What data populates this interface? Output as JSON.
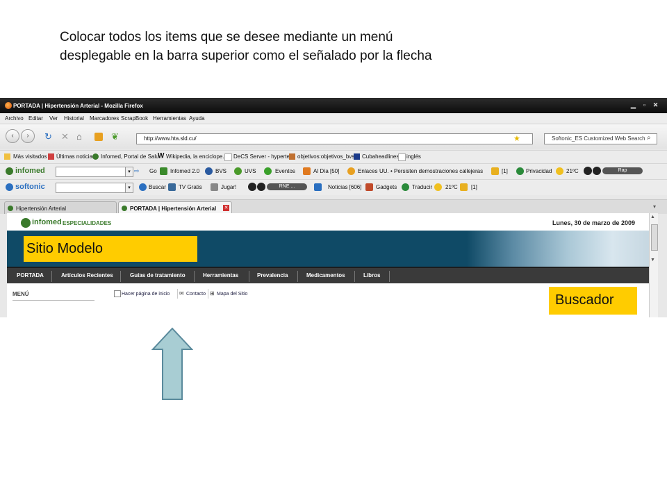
{
  "instruction": {
    "line1": "Colocar todos los items que se desee mediante un menú",
    "line2": "desplegable en la barra superior como el señalado por la flecha"
  },
  "browser": {
    "window_title": "PORTADA | Hipertensión Arterial - Mozilla Firefox",
    "menu": [
      "Archivo",
      "Editar",
      "Ver",
      "Historial",
      "Marcadores",
      "ScrapBook",
      "Herramientas",
      "Ayuda"
    ],
    "url": "http://www.hta.sld.cu/",
    "search_placeholder": "Softonic_ES Customized Web Search",
    "bookmarks": [
      "Más visitados",
      "Últimas noticias",
      "Infomed, Portal de Salu...",
      "Wikipedia, la enciclope...",
      "DeCS Server - hyperte...",
      "objetivos:objetivos_bvs...",
      "Cubaheadlines",
      "inglés"
    ],
    "infomed_toolbar": {
      "brand": "infomed",
      "go": "Go",
      "items": [
        "Infomed 2.0",
        "BVS",
        "UVS",
        "Eventos",
        "Al Día [50]",
        "Enlaces"
      ],
      "ticker": "UU. • Persisten demostraciones callejeras",
      "mail_count": "[1]",
      "privacy": "Privacidad",
      "temp": "21ºC",
      "radio": "Rap"
    },
    "softonic_toolbar": {
      "brand": "softonic",
      "items": [
        "Buscar",
        "TV Gratis",
        "Jugar!"
      ],
      "radio": "RNE ...",
      "news": "Noticias [606]",
      "gadgets": "Gadgets",
      "translate": "Traducir",
      "temp": "21ºC",
      "count": "[1]"
    },
    "tabs": [
      "Hipertensión Arterial",
      "PORTADA | Hipertensión Arterial"
    ]
  },
  "page": {
    "logo_main": "infomed",
    "logo_sub": "ESPECIALIDADES",
    "date": "Lunes, 30 de marzo de 2009",
    "nav": [
      "PORTADA",
      "Artículos Recientes",
      "Guías de tratamiento",
      "Herramientas",
      "Prevalencia",
      "Medicamentos",
      "Libros"
    ],
    "menu_heading": "MENÚ",
    "links": [
      "Hacer página de inicio",
      "Contacto",
      "Mapa del Sitio"
    ]
  },
  "annotations": {
    "sitio": "Sitio Modelo",
    "buscador": "Buscador"
  },
  "colors": {
    "highlight": "#ffcc00",
    "arrow_fill": "#a8cdd3",
    "arrow_stroke": "#5a8a9c",
    "banner": "#0f4a66",
    "nav": "#3a3a3a",
    "brand_green": "#3a7a2b"
  }
}
